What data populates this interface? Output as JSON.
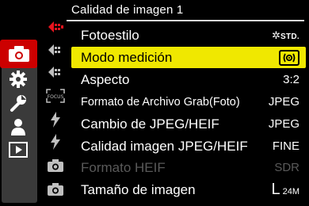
{
  "header": {
    "title": "Calidad de imagen 1"
  },
  "colors": {
    "accent": "#cc0000",
    "highlight": "#f0e800",
    "disabled": "#5a5a5a"
  },
  "categories": [
    {
      "name": "photo-camera-icon",
      "active": true
    },
    {
      "name": "gear-icon",
      "active": false
    },
    {
      "name": "wrench-icon",
      "active": false
    },
    {
      "name": "person-icon",
      "active": false
    },
    {
      "name": "playback-icon",
      "active": false
    }
  ],
  "subpages": [
    {
      "name": "quality-1-icon",
      "active": true
    },
    {
      "name": "quality-2-icon"
    },
    {
      "name": "quality-3-icon"
    },
    {
      "name": "focus-icon",
      "label": "FOCUS"
    },
    {
      "name": "flash-icon-1"
    },
    {
      "name": "flash-icon-2"
    },
    {
      "name": "camera-icon-1"
    },
    {
      "name": "camera-icon-2"
    }
  ],
  "menu": [
    {
      "label": "Fotoestilo",
      "value": "STD.",
      "value_icon": "photo-style-icon"
    },
    {
      "label": "Modo medición",
      "value_icon": "multi-metering-icon",
      "selected": true
    },
    {
      "label": "Aspecto",
      "value": "3:2"
    },
    {
      "label": "Formato de Archivo Grab(Foto)",
      "value": "JPEG"
    },
    {
      "label": "Cambio de JPEG/HEIF",
      "value": "JPEG"
    },
    {
      "label": "Calidad imagen JPEG/HEIF",
      "value": "FINE"
    },
    {
      "label": "Formato HEIF",
      "value": "SDR",
      "disabled": true
    },
    {
      "label": "Tamaño de imagen",
      "value_main": "L",
      "value_sub": "24M"
    }
  ]
}
